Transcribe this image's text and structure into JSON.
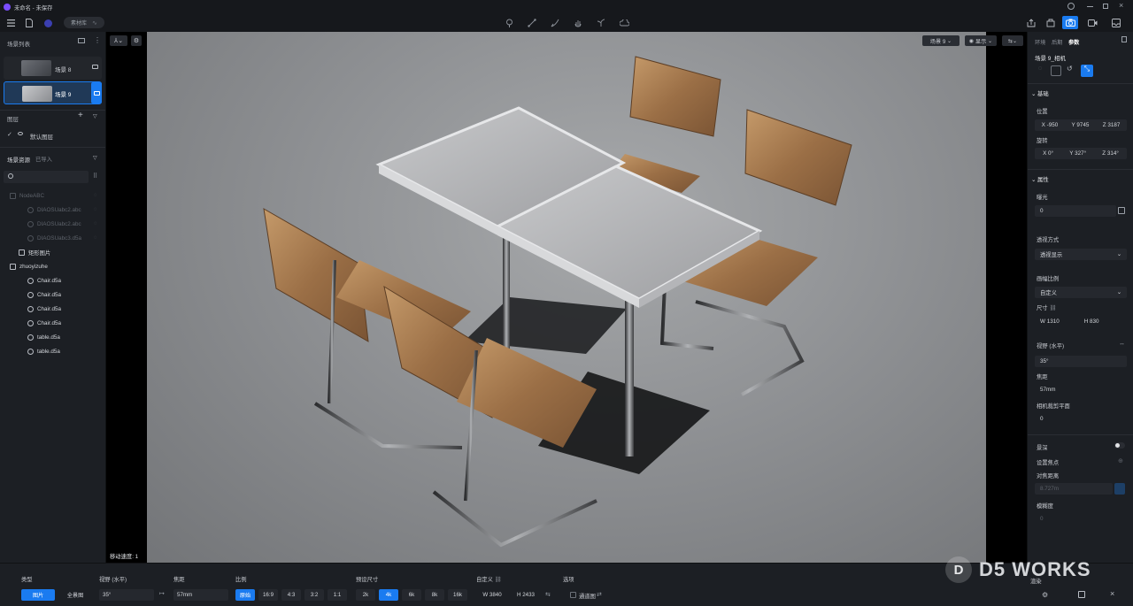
{
  "window": {
    "title": "未命名 - 未保存"
  },
  "toolbar": {
    "material_label": "素材库"
  },
  "scene_list": {
    "title": "场景列表",
    "scenes": [
      {
        "name": "场景 8"
      },
      {
        "name": "场景 9"
      }
    ]
  },
  "layers": {
    "title": "图层",
    "default_layer": "默认图层"
  },
  "assets": {
    "title": "场景资源",
    "tab_imported": "已导入",
    "search_placeholder": "",
    "tree": [
      "NodeABC",
      "DIAOSUabc2.abc",
      "DIAOSUabc2.abc",
      "DIAOSUabc3.d5a",
      "矩形图片",
      "zhuoyizuhe",
      "Chair.d5a",
      "Chair.d5a",
      "Chair.d5a",
      "Chair.d5a",
      "table.d5a",
      "table.d5a"
    ]
  },
  "viewport": {
    "scene_dropdown": "场景 9",
    "display_dropdown": "显示",
    "move_speed": "移动速度: 1",
    "watermark": "D5 WORKS"
  },
  "right_panel": {
    "tabs": [
      "环境",
      "后期",
      "参数"
    ],
    "camera_name": "场景 9_相机",
    "section_basic": "基础",
    "position_label": "位置",
    "pos": {
      "x": "X -950",
      "y": "Y 9745",
      "z": "Z 3187"
    },
    "rotation_label": "旋转",
    "rot": {
      "x": "X 0°",
      "y": "Y 327°",
      "z": "Z 314°"
    },
    "section_props": "属性",
    "exposure_label": "曝光",
    "exposure_value": "0",
    "projection_label": "透视方式",
    "projection_value": "透视显示",
    "aspect_label": "画幅比例",
    "aspect_value": "自定义",
    "size_label": "尺寸",
    "size_w": "W 1310",
    "size_h": "H 830",
    "fov_label": "视野 (水平)",
    "fov_value": "35°",
    "focal_label": "焦距",
    "focal_value": "57mm",
    "clip_label": "相机裁剪平面",
    "clip_value": "0",
    "dof_label": "景深",
    "focus_label": "设置焦点",
    "focus_dist_label": "对焦距离",
    "focus_dist_value": "8.727m",
    "blur_label": "模糊度",
    "blur_value": "0"
  },
  "bottom": {
    "type_label": "类型",
    "type_image": "图片",
    "type_panorama": "全景图",
    "fov_label": "视野 (水平)",
    "fov_value": "35°",
    "focal_label": "焦距",
    "focal_value": "57mm",
    "ratio_label": "比例",
    "ratios": [
      "原始",
      "16:9",
      "4:3",
      "3:2",
      "1:1"
    ],
    "preset_label": "预设尺寸",
    "presets": [
      "2k",
      "4k",
      "6k",
      "8k",
      "16k"
    ],
    "custom_label": "自定义",
    "custom_w": "W 3840",
    "custom_h": "H 2433",
    "options_label": "选项",
    "channel_label": "通道图",
    "render_label": "渲染"
  },
  "colors": {
    "accent": "#1a7bf0",
    "bg": "#16181c",
    "panel": "#1c1f24"
  }
}
